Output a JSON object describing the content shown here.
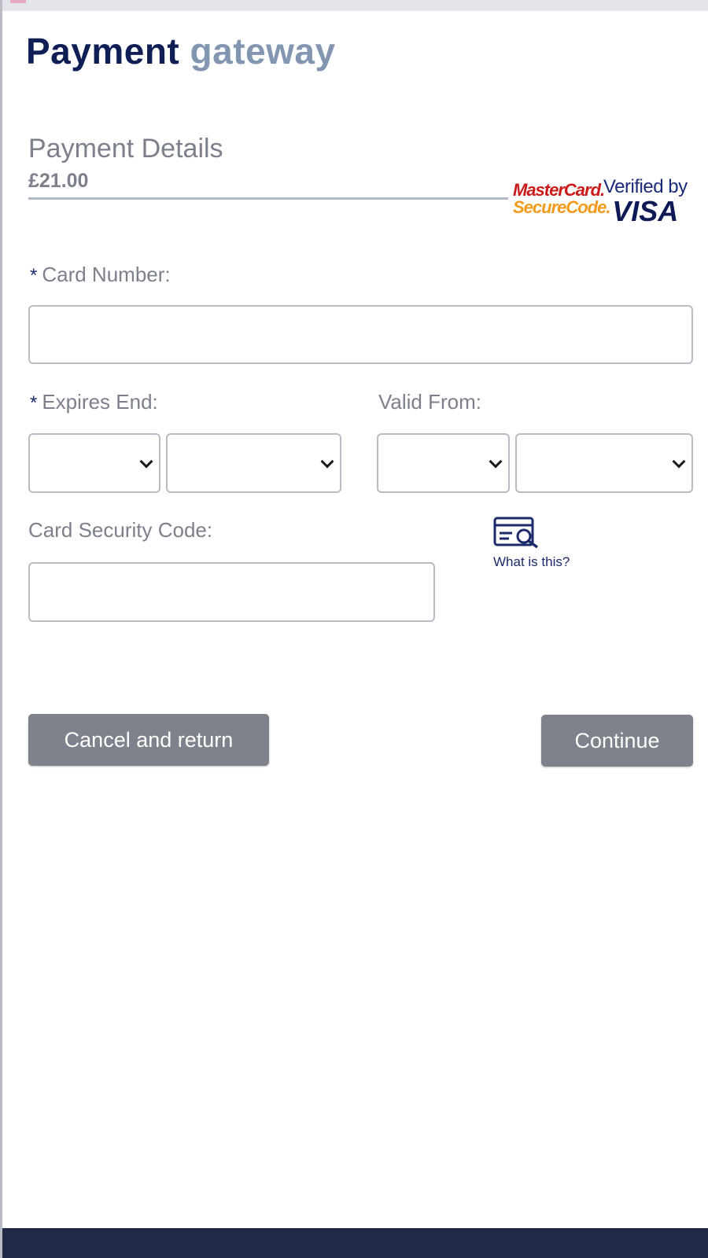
{
  "brand": {
    "word1": "Payment",
    "word2": "gateway"
  },
  "payment": {
    "section_title": "Payment Details",
    "amount": "£21.00"
  },
  "logos": {
    "mastercard_line1": "MasterCard.",
    "mastercard_line2": "SecureCode.",
    "visa_line1": "Verified by",
    "visa_line2": "VISA"
  },
  "form": {
    "required_marker": "*",
    "card_number_label": "Card Number:",
    "card_number_value": "",
    "expires_label": "Expires End:",
    "expires_month_value": "",
    "expires_year_value": "",
    "valid_from_label": "Valid From:",
    "valid_from_month_value": "",
    "valid_from_year_value": "",
    "security_code_label": "Card Security Code:",
    "security_code_value": "",
    "help_link": "What is this?"
  },
  "actions": {
    "cancel": "Cancel and return",
    "continue": "Continue"
  },
  "colors": {
    "brand_dark": "#0f1f55",
    "brand_light": "#8296b2",
    "button_bg": "#7d828b",
    "footer_bar": "#212848"
  },
  "icons": {
    "help": "card-search-icon",
    "select_arrow": "chevron-down-icon"
  }
}
